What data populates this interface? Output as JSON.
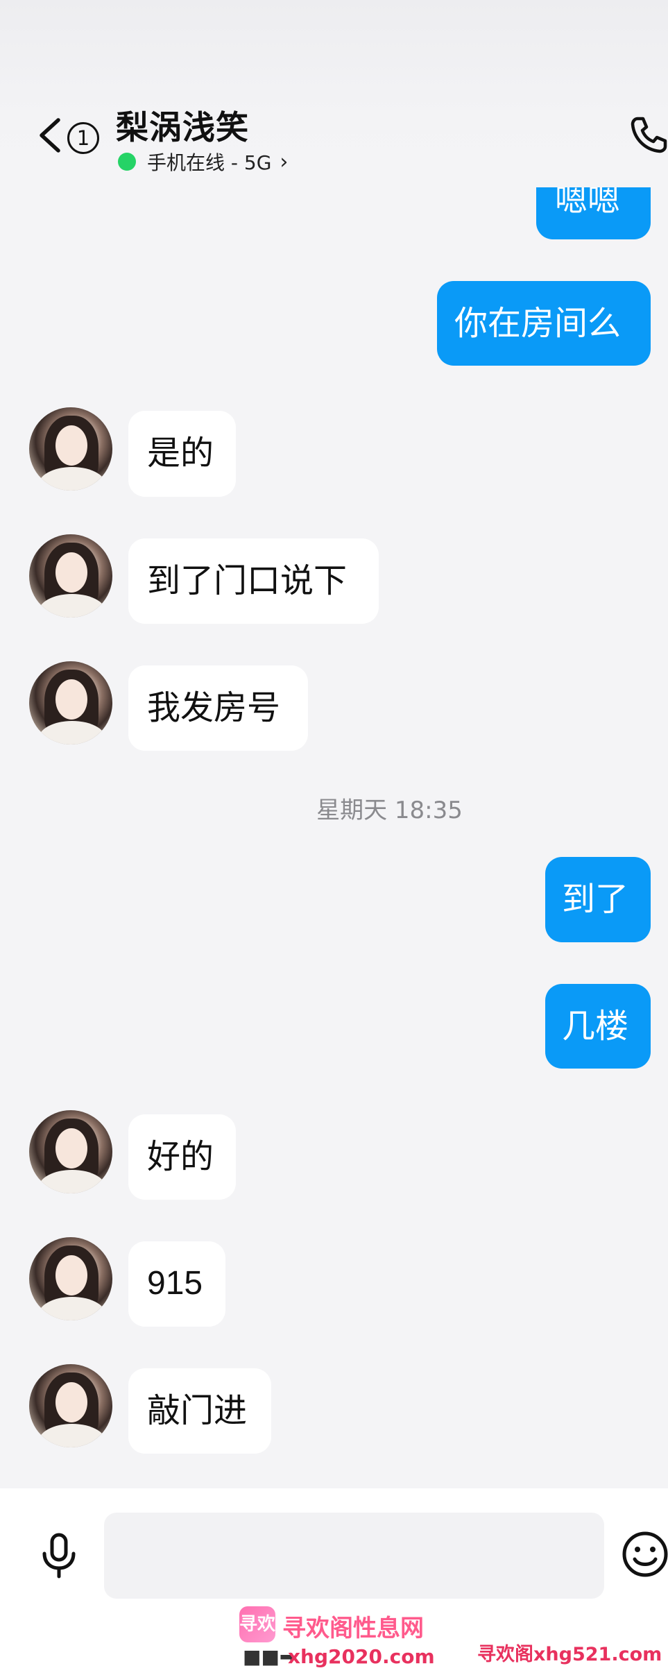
{
  "header": {
    "unread_count": "1",
    "contact_name": "梨涡浅笑",
    "status_text": "手机在线 - 5G"
  },
  "colors": {
    "outgoing_bubble": "#0a9af7",
    "incoming_bubble": "#ffffff",
    "online_dot": "#25d366"
  },
  "messages": [
    {
      "dir": "out",
      "text": "嗯嗯"
    },
    {
      "dir": "out",
      "text": "你在房间么"
    },
    {
      "dir": "in",
      "text": "是的"
    },
    {
      "dir": "in",
      "text": "到了门口说下"
    },
    {
      "dir": "in",
      "text": "我发房号"
    },
    {
      "dir": "out",
      "text": "到了"
    },
    {
      "dir": "out",
      "text": "几楼"
    },
    {
      "dir": "in",
      "text": "好的"
    },
    {
      "dir": "in",
      "text": "915"
    },
    {
      "dir": "in",
      "text": "敲门进"
    }
  ],
  "timestamp": "星期天 18:35",
  "input": {
    "placeholder": ""
  },
  "watermark": {
    "logo_text": "寻欢",
    "title": "寻欢阁性息网",
    "url": "xhg2020.com",
    "right_text": "寻欢阁xhg521.com"
  },
  "icons": [
    "chevron-left-icon",
    "phone-icon",
    "microphone-icon",
    "emoji-icon"
  ]
}
